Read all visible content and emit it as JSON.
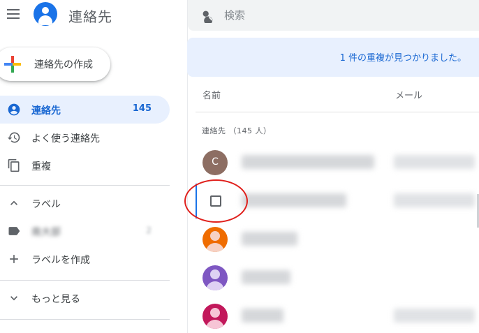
{
  "app": {
    "title": "連絡先"
  },
  "sidebar": {
    "create_label": "連絡先の作成",
    "items": [
      {
        "label": "連絡先",
        "count": "145",
        "icon": "person-icon",
        "active": true
      },
      {
        "label": "よく使う連絡先",
        "icon": "history-icon"
      },
      {
        "label": "重複",
        "icon": "copy-icon"
      }
    ],
    "labels_section": {
      "header": "ラベル",
      "items": [
        {
          "label": "南大部",
          "count": "2",
          "icon": "label-tag-icon"
        }
      ],
      "create_label": "ラベルを作成"
    },
    "more_label": "もっと見る"
  },
  "search": {
    "placeholder": "検索"
  },
  "banner": {
    "text": "1 件の重複が見つかりました。"
  },
  "list": {
    "columns": {
      "name": "名前",
      "email": "メール"
    },
    "section_label": "連絡先 （145 人）",
    "rows": [
      {
        "avatar_type": "letter",
        "letter": "C",
        "color": "#8d6e63"
      },
      {
        "avatar_type": "checkbox",
        "selected": true
      },
      {
        "avatar_type": "person",
        "color": "#ef6c00"
      },
      {
        "avatar_type": "person",
        "color": "#7e57c2"
      },
      {
        "avatar_type": "person",
        "color": "#c2185b"
      }
    ]
  },
  "colors": {
    "accent": "#1a73e8",
    "active_bg": "#e8f0fe",
    "highlight_ring": "#e0201c"
  }
}
